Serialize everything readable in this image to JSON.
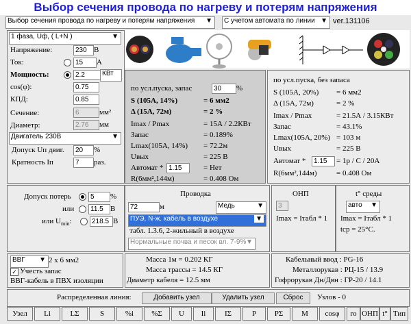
{
  "title": "Выбор сечения провода по нагреву и потерям напряжения",
  "top": {
    "mode": "Выбор сечения провода по нагреву и потерям напряжения",
    "option": "С учетом автомата по линии",
    "version": "ver.131106"
  },
  "left": {
    "phase": "1 фаза, Uф,  ( L+N )",
    "voltage_label": "Напряжение:",
    "voltage": "230",
    "voltage_unit": "В",
    "current_label": "Ток:",
    "current": "15",
    "current_unit": "А",
    "power_label": "Мощность:",
    "power": "2.2",
    "power_unit": "КВт",
    "cos_label": "cos(φ):",
    "cos": "0.75",
    "kpd_label": "КПД:",
    "kpd": "0.85",
    "section_label": "Сечение:",
    "section": "6",
    "section_unit": "мм²",
    "diameter_label": "Диаметр:",
    "diameter": "2.76",
    "diameter_unit": "мм",
    "motor": "Двигатель 230В",
    "tol_label": "Допуск Uп двиг.",
    "tol": "20",
    "tol_unit": "%",
    "mult_label": "Кратность Iп",
    "mult": "7",
    "mult_unit": "раз."
  },
  "mid": {
    "start_label": "по усл.пуска, запас",
    "start_value": "30",
    "start_unit": "%",
    "l1a": "S (105А, 14%)",
    "l1b": "= 6 мм2",
    "l2a": "Δ (15А, 72м)",
    "l2b": "= 2 %",
    "l3a": "Imax / Pmax",
    "l3b": "= 15А / 2.2КВт",
    "l4a": "Запас",
    "l4b": "= 0.189%",
    "l5a": "Lmax(105А, 14%)",
    "l5b": "= 72.2м",
    "l6a": "Uвых",
    "l6b": "= 225 В",
    "l7a": "Автомат *",
    "l7v": "1.15",
    "l7b": "= Нет",
    "l8a": "R(6мм²,144м)",
    "l8b": "= 0.408 Ом"
  },
  "right": {
    "title": "по усл.пуска, без запаса",
    "r1a": "S (105А, 20%)",
    "r1b": "= 6 мм2",
    "r2a": "Δ (15А, 72м)",
    "r2b": "= 2 %",
    "r3a": "Imax / Pmax",
    "r3b": "= 21.5А / 3.15КВт",
    "r4a": "Запас",
    "r4b": "= 43.1%",
    "r5a": "Lmax(105А, 20%)",
    "r5b": "= 103 м",
    "r6a": "Uвых",
    "r6b": "= 225 В",
    "r7a": "Автомат *",
    "r7v": "1.15",
    "r7b": "= 1р / С / 20А",
    "r8a": "R(6мм²,144м)",
    "r8b": "= 0.408 Ом"
  },
  "losses": {
    "label": "Допуск потерь",
    "v1": "5",
    "u1": "%",
    "or1": "или",
    "v2": "11.5",
    "u2": "В",
    "or2": "или U",
    "v3": "218.5",
    "u3": "В"
  },
  "wire": {
    "title": "Проводка",
    "length": "72",
    "length_unit": "м",
    "metal": "Медь",
    "rule": "ПУЭ, N-ж. кабель в воздухе",
    "table": "табл. 1.3.6, 2-жильный в воздухе",
    "soil": "Нормальные почва и песок вл. 7-9%"
  },
  "onp": {
    "title": "ОНП",
    "value": "3",
    "formula": "Imax = Iтабл * 1"
  },
  "temp": {
    "title": "t° среды",
    "mode": "авто",
    "formula": "Imax = Iтабл * 1",
    "tcp": "tср = 25°С."
  },
  "cable": {
    "type": "ВВГ",
    "size": "2 x 6 мм2",
    "reserve": "Учесть запас",
    "desc": "ВВГ-кабель в ПВХ изоляции"
  },
  "mass": {
    "m1": "Масса 1м = 0.202  КГ",
    "m2": "Масса трассы = 14.5  КГ",
    "m3": "Диаметр кабеля = 12.5  мм"
  },
  "entry": {
    "e1": "Кабельный ввод : PG-16",
    "e2": "Металлорукав : РЦ-15 / 13.9",
    "e3": "Гофрорукав Дн/Двн : ГР-20 / 14.1"
  },
  "dist": {
    "label": "Распределенная линия:",
    "add": "Добавить узел",
    "remove": "Удалить узел",
    "reset": "Сброс",
    "nodes": "Узлов - 0"
  },
  "headers": [
    "Узел",
    "Li",
    "LΣ",
    "S",
    "%i",
    "%Σ",
    "U",
    "Ii",
    "IΣ",
    "P",
    "PΣ",
    "M",
    "cosφ",
    "ro",
    "ОНП",
    "t°",
    "Тип"
  ]
}
